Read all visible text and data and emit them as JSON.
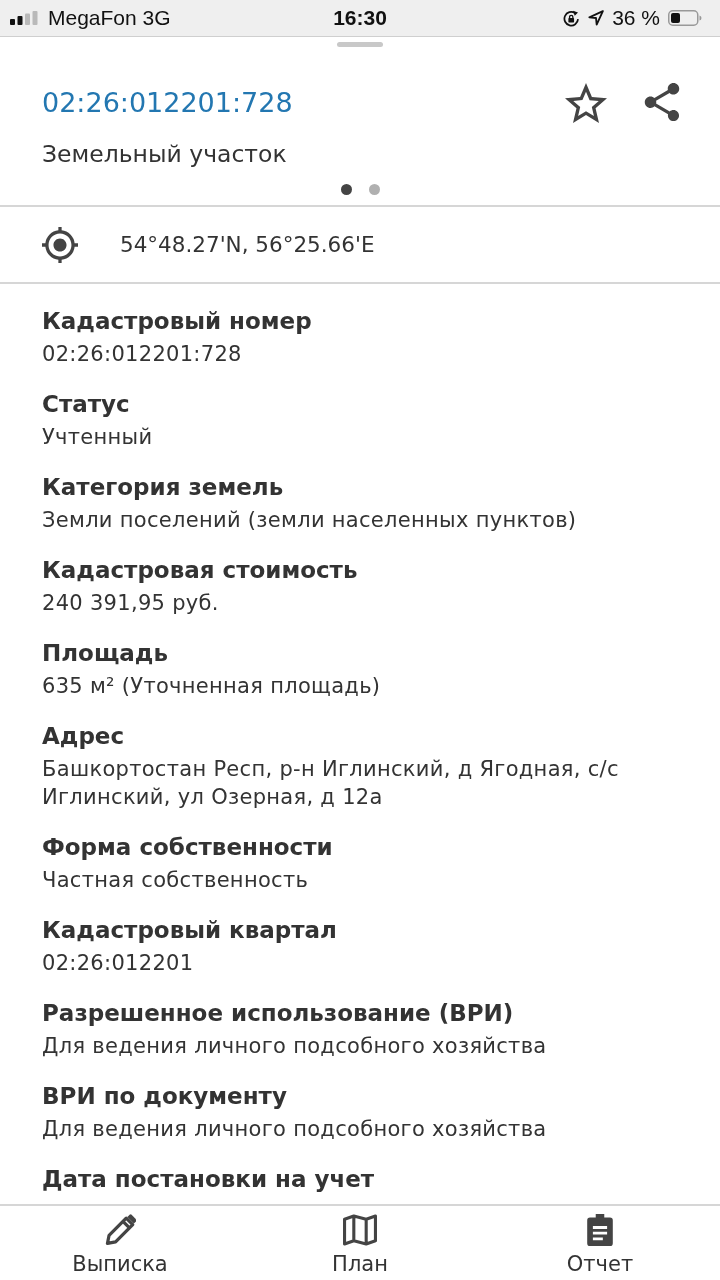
{
  "status_bar": {
    "carrier": "MegaFon 3G",
    "time": "16:30",
    "battery": "36 %"
  },
  "header": {
    "title": "02:26:012201:728",
    "subtitle": "Земельный участок",
    "pages": [
      {
        "selected": true
      },
      {
        "selected": false
      }
    ]
  },
  "location": {
    "coordinates": "54°48.27'N, 56°25.66'E"
  },
  "fields": [
    {
      "label": "Кадастровый номер",
      "value": "02:26:012201:728"
    },
    {
      "label": "Статус",
      "value": "Учтенный"
    },
    {
      "label": "Категория земель",
      "value": "Земли поселений (земли населенных пунктов)"
    },
    {
      "label": "Кадастровая стоимость",
      "value": "240 391,95 руб."
    },
    {
      "label": "Площадь",
      "value": "635 м² (Уточненная площадь)"
    },
    {
      "label": "Адрес",
      "value": "Башкортостан Респ, р-н Иглинский, д Ягодная, с/с Иглинский, ул Озерная, д 12а"
    },
    {
      "label": "Форма собственности",
      "value": "Частная собственность"
    },
    {
      "label": "Кадастровый квартал",
      "value": "02:26:012201"
    },
    {
      "label": "Разрешенное использование (ВРИ)",
      "value": "Для ведения личного подсобного хозяйства"
    },
    {
      "label": "ВРИ по документу",
      "value": "Для ведения личного подсобного хозяйства"
    },
    {
      "label": "Дата постановки на учет"
    }
  ],
  "tab_bar": {
    "items": [
      {
        "label": "Выписка"
      },
      {
        "label": "План"
      },
      {
        "label": "Отчет"
      }
    ]
  }
}
